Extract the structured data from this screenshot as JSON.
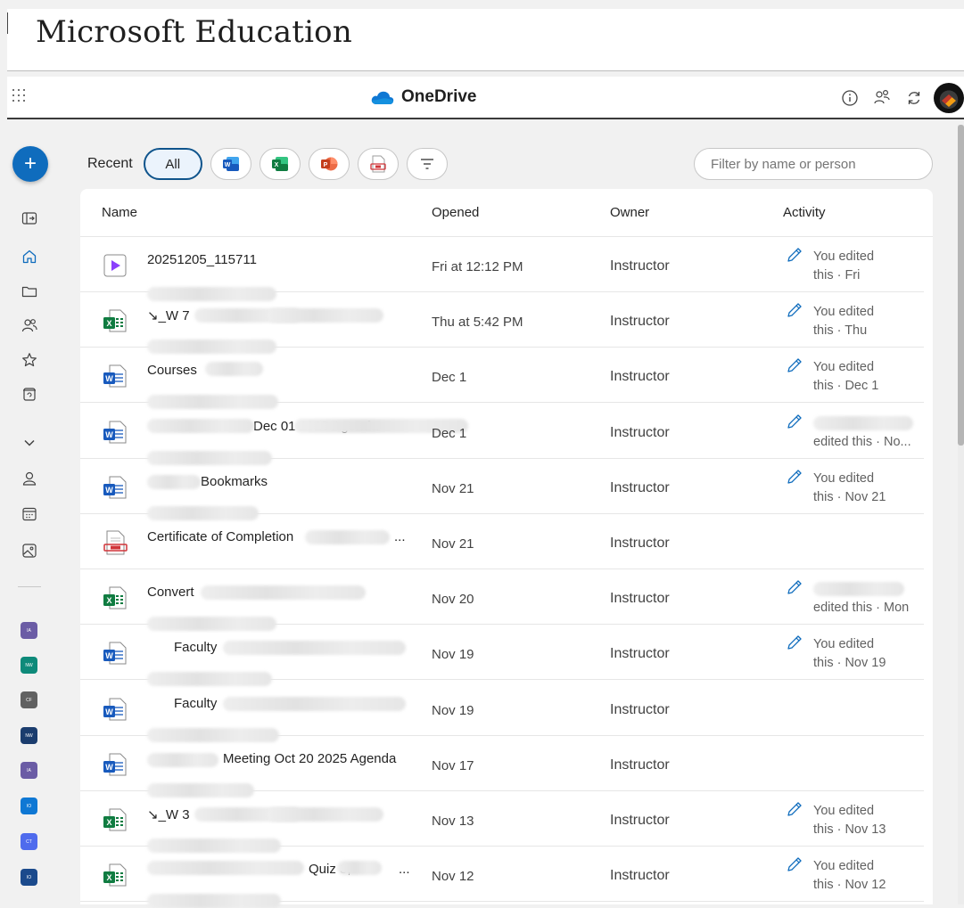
{
  "banner": {
    "title": "Microsoft Education"
  },
  "header": {
    "brand": "OneDrive",
    "icons": [
      "waffle-icon",
      "info-icon",
      "share-people-icon",
      "sync-icon",
      "avatar"
    ]
  },
  "rail": {
    "create_label": "+",
    "items": [
      "sign-out-icon",
      "home-icon",
      "folder-icon",
      "people-icon",
      "star-icon",
      "recycle-bin-icon",
      "chevron-down-icon",
      "person-icon",
      "calendar-icon",
      "image-icon"
    ],
    "places": [
      {
        "abbr": "IA",
        "color": "#6b5ca5"
      },
      {
        "abbr": "NW",
        "color": "#0e8a7a"
      },
      {
        "abbr": "CF",
        "color": "#616161"
      },
      {
        "abbr": "NW",
        "color": "#1b3d6e"
      },
      {
        "abbr": "IA",
        "color": "#6b5ca5"
      },
      {
        "abbr": "IO",
        "color": "#0f78d4"
      },
      {
        "abbr": "CT",
        "color": "#4f6bed"
      },
      {
        "abbr": "IO",
        "color": "#1b4a8c"
      }
    ]
  },
  "filters": {
    "recent_label": "Recent",
    "all_label": "All",
    "type_icons": [
      "word-icon",
      "excel-icon",
      "powerpoint-icon",
      "pdf-icon",
      "filter-icon"
    ],
    "search_placeholder": "Filter by name or person"
  },
  "columns": {
    "name": "Name",
    "opened": "Opened",
    "owner": "Owner",
    "activity": "Activity"
  },
  "files": [
    {
      "type": "video",
      "name": "20251205_115711",
      "opened": "Fri at 12:12 PM",
      "owner": "Instructor",
      "activity": [
        "You edited",
        "this · Fri"
      ],
      "has_activity_icon": true
    },
    {
      "type": "excel",
      "name": "↘_W                                                          7",
      "opened": "Thu at 5:42 PM",
      "owner": "Instructor",
      "activity": [
        "You edited",
        "this · Thu"
      ],
      "has_activity_icon": true
    },
    {
      "type": "word",
      "name": "Courses",
      "opened": "Dec 1",
      "owner": "Instructor",
      "activity": [
        "You edited",
        "this · Dec 1"
      ],
      "has_activity_icon": true
    },
    {
      "type": "word",
      "name": "Dec 01 2025 Agenda",
      "opened": "Dec 1",
      "owner": "Instructor",
      "activity": [
        "",
        "edited this · No..."
      ],
      "has_activity_icon": true
    },
    {
      "type": "word",
      "name": "Bookmarks",
      "opened": "Nov 21",
      "owner": "Instructor",
      "activity": [
        "You edited",
        "this · Nov 21"
      ],
      "has_activity_icon": true
    },
    {
      "type": "pdf",
      "name": "Certificate of Completion",
      "opened": "Nov 21",
      "owner": "Instructor",
      "activity": [
        "",
        ""
      ],
      "has_activity_icon": false
    },
    {
      "type": "excel",
      "name": "Convert",
      "opened": "Nov 20",
      "owner": "Instructor",
      "activity": [
        "",
        "edited this · Mon"
      ],
      "has_activity_icon": true
    },
    {
      "type": "word",
      "name": "Faculty",
      "opened": "Nov 19",
      "owner": "Instructor",
      "activity": [
        "You edited",
        "this · Nov 19"
      ],
      "has_activity_icon": true
    },
    {
      "type": "word",
      "name": "Faculty",
      "opened": "Nov 19",
      "owner": "Instructor",
      "activity": [
        "",
        ""
      ],
      "has_activity_icon": false
    },
    {
      "type": "word",
      "name": "Meeting Oct 20 2025 Agenda",
      "opened": "Nov 17",
      "owner": "Instructor",
      "activity": [
        "",
        ""
      ],
      "has_activity_icon": false
    },
    {
      "type": "excel",
      "name": "↘_W                                                          3",
      "opened": "Nov 13",
      "owner": "Instructor",
      "activity": [
        "You edited",
        "this · Nov 13"
      ],
      "has_activity_icon": true
    },
    {
      "type": "excel",
      "name": "Quiz 3,",
      "opened": "Nov 12",
      "owner": "Instructor",
      "activity": [
        "You edited",
        "this · Nov 12"
      ],
      "has_activity_icon": true
    }
  ],
  "truncation_suffix": "..."
}
